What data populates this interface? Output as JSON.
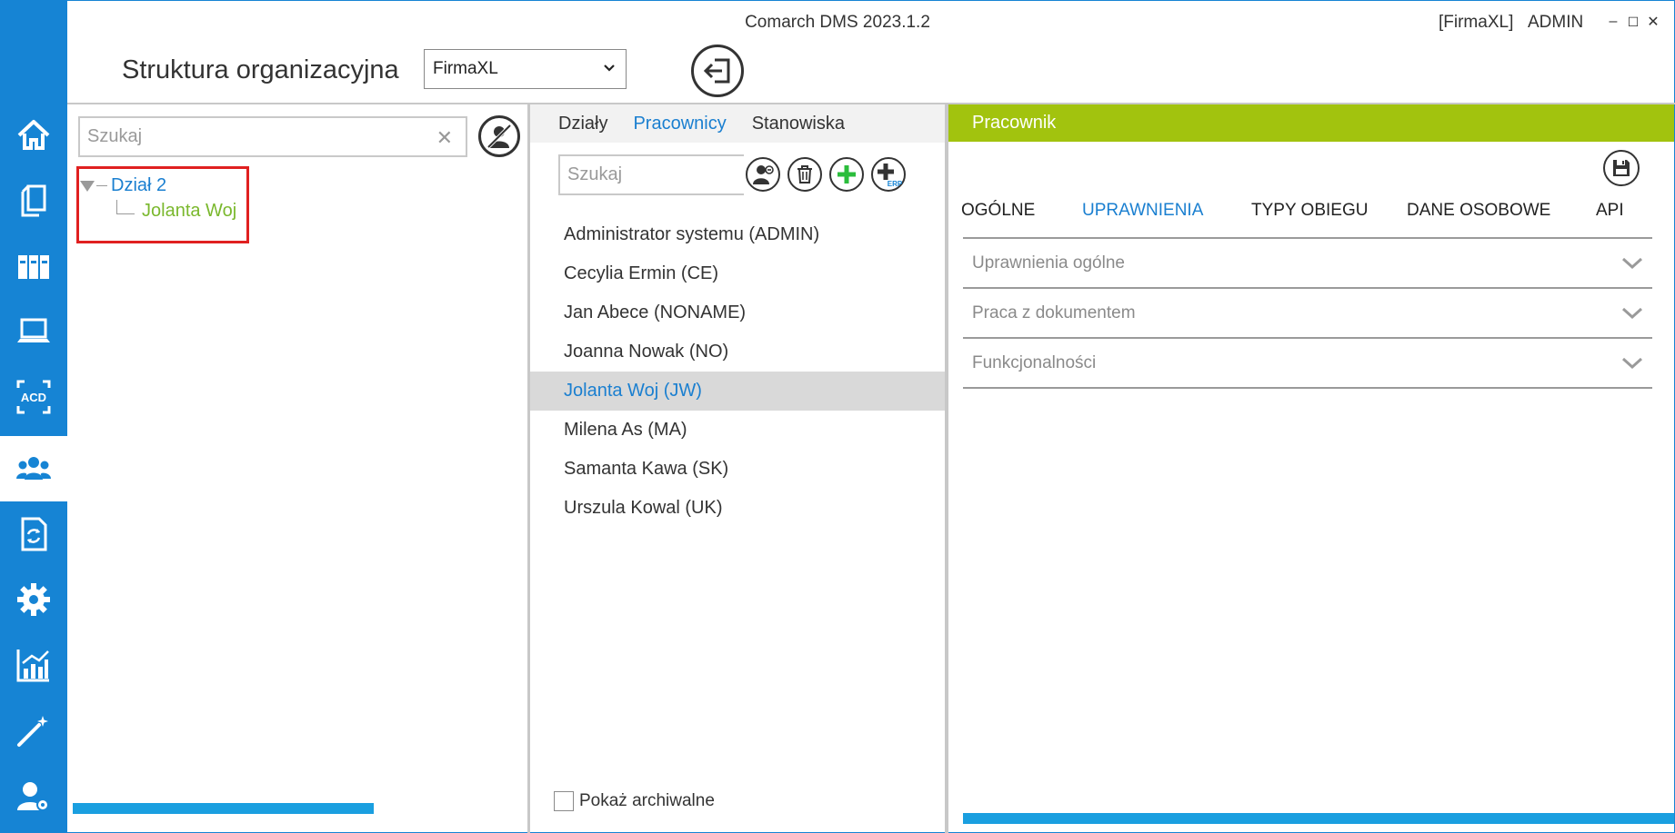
{
  "window": {
    "title": "Comarch DMS 2023.1.2",
    "company_tag": "[FirmaXL]",
    "user": "ADMIN",
    "minimize": "–",
    "maximize": "☐",
    "close": "✕"
  },
  "header": {
    "page_title": "Struktura organizacyjna",
    "company_selected": "FirmaXL"
  },
  "sidebar": {
    "items": [
      {
        "name": "home",
        "icon": "home-icon"
      },
      {
        "name": "documents",
        "icon": "documents-icon"
      },
      {
        "name": "repository",
        "icon": "binders-icon"
      },
      {
        "name": "workstation",
        "icon": "laptop-icon"
      },
      {
        "name": "acd",
        "icon": "acd-icon",
        "label": "ACD"
      },
      {
        "name": "org-structure",
        "icon": "users-icon",
        "active": true
      },
      {
        "name": "workflow",
        "icon": "document-sync-icon"
      },
      {
        "name": "settings",
        "icon": "gear-icon"
      },
      {
        "name": "reports",
        "icon": "chart-icon"
      },
      {
        "name": "wizard",
        "icon": "magic-wand-icon"
      },
      {
        "name": "admin-settings",
        "icon": "user-settings-icon"
      }
    ],
    "accent_color": "#1684d4"
  },
  "tree": {
    "search_placeholder": "Szukaj",
    "clear_symbol": "✕",
    "nodes": [
      {
        "label": "Dział 2",
        "level": 0
      },
      {
        "label": "Jolanta Woj",
        "level": 1
      }
    ]
  },
  "list_panel": {
    "tabs": [
      {
        "label": "Działy",
        "active": false
      },
      {
        "label": "Pracownicy",
        "active": true
      },
      {
        "label": "Stanowiska",
        "active": false
      }
    ],
    "search_placeholder": "Szukaj",
    "employees": [
      {
        "label": "Administrator systemu (ADMIN)",
        "selected": false
      },
      {
        "label": "Cecylia Ermin (CE)",
        "selected": false
      },
      {
        "label": "Jan Abece (NONAME)",
        "selected": false
      },
      {
        "label": "Joanna Nowak (NO)",
        "selected": false
      },
      {
        "label": "Jolanta Woj (JW)",
        "selected": true
      },
      {
        "label": "Milena As (MA)",
        "selected": false
      },
      {
        "label": "Samanta Kawa (SK)",
        "selected": false
      },
      {
        "label": "Urszula Kowal (UK)",
        "selected": false
      }
    ],
    "show_archived_label": "Pokaż archiwalne",
    "show_archived": false
  },
  "detail": {
    "header": "Pracownik",
    "header_color": "#a2c30e",
    "tabs": [
      {
        "label": "OGÓLNE",
        "active": false
      },
      {
        "label": "UPRAWNIENIA",
        "active": true
      },
      {
        "label": "TYPY OBIEGU",
        "active": false
      },
      {
        "label": "DANE OSOBOWE",
        "active": false
      },
      {
        "label": "API",
        "active": false
      }
    ],
    "sections": [
      {
        "label": "Uprawnienia ogólne"
      },
      {
        "label": "Praca z dokumentem"
      },
      {
        "label": "Funkcjonalności"
      }
    ]
  }
}
